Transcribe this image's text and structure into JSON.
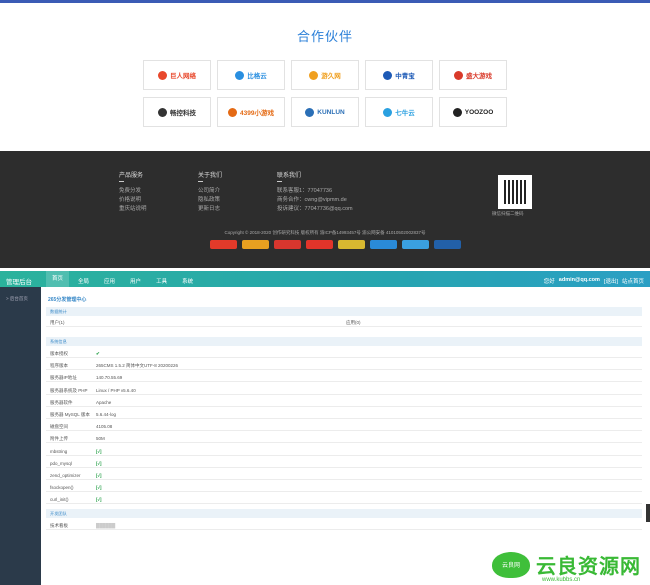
{
  "partners": {
    "title": "合作伙伴",
    "logos": [
      {
        "name": "巨人网络",
        "color": "#e8482c"
      },
      {
        "name": "比格云",
        "color": "#2a8fe0"
      },
      {
        "name": "游久网",
        "color": "#f0a020"
      },
      {
        "name": "中青宝",
        "color": "#1d5ab6"
      },
      {
        "name": "盛大游戏",
        "color": "#d93a2a"
      },
      {
        "name": "畅控科技",
        "color": "#333333"
      },
      {
        "name": "4399小游戏",
        "color": "#e46a14"
      },
      {
        "name": "KUNLUN",
        "color": "#2b6fb6"
      },
      {
        "name": "七牛云",
        "color": "#2aa0e0"
      },
      {
        "name": "YOOZOO",
        "color": "#222222"
      }
    ]
  },
  "footer": {
    "col1": {
      "head": "产品服务",
      "lines": [
        "免费分发",
        "价格说明",
        "重庆站说明"
      ]
    },
    "col2": {
      "head": "关于我们",
      "lines": [
        "公司简介",
        "隐私政策",
        "更新日志"
      ]
    },
    "col3": {
      "head": "联系我们",
      "lines": [
        "联系客服1：77047736",
        "商务合作：cwng@vipmm.de",
        "投诉建议：77047736@qq.com"
      ]
    },
    "qr_caption": "微信扫描二维码",
    "copyright": "Copyright © 2018-2020 创作研究科技 版权所有 渝ICP备14993457号    渝公网安备 41010502002837号",
    "badges": [
      "#e23a2a",
      "#e8a020",
      "#d8362e",
      "#e2342a",
      "#d8b830",
      "#2a8ad8",
      "#3aa0e0",
      "#2260a8"
    ]
  },
  "admin": {
    "brand": "管理后台",
    "nav": [
      "首页",
      "全局",
      "应用",
      "用户",
      "工具",
      "系统"
    ],
    "active_nav": "首页",
    "user": {
      "label": "您好",
      "email": "admin@qq.com",
      "logout": "[退出]",
      "home": "站点首页"
    },
    "sidebar": [
      "> 后台首页"
    ],
    "crumb": "265分发管理中心",
    "stats_header": "数据统计",
    "stats": {
      "users": "用户(1)",
      "apps": "应用(0)"
    },
    "sysinfo_header": "系统信息",
    "sysinfo": [
      {
        "k": "版本授权",
        "v": "✔",
        "ok": true
      },
      {
        "k": "程序版本",
        "v": "265CMS 1.5.2 简体中文UTF-8 20200226"
      },
      {
        "k": "服务器IP地址",
        "v": "140.70.55.69"
      },
      {
        "k": "服务器系统及 PHP",
        "v": "Linux / PHP v5.6.40"
      },
      {
        "k": "服务器软件",
        "v": "Apache"
      },
      {
        "k": "服务器 MySQL 版本",
        "v": "5.6.44-log"
      },
      {
        "k": "磁盘空间",
        "v": "4105.08"
      },
      {
        "k": "附件上传",
        "v": "50M"
      },
      {
        "k": "mbstring",
        "v": "[√]",
        "ok": true
      },
      {
        "k": "pdo_mysql",
        "v": "[√]",
        "ok": true
      },
      {
        "k": "zend_optimizer",
        "v": "[√]",
        "ok": true
      },
      {
        "k": "fsockopen()",
        "v": "[√]",
        "ok": true
      },
      {
        "k": "curl_init()",
        "v": "[√]",
        "ok": true
      }
    ],
    "dev_header": "开发团队",
    "dev": {
      "k": "技术看板",
      "v": "██████"
    }
  },
  "watermark": {
    "badge": "云良网",
    "title": "云良资源网",
    "url": "www.kubbs.cn"
  }
}
